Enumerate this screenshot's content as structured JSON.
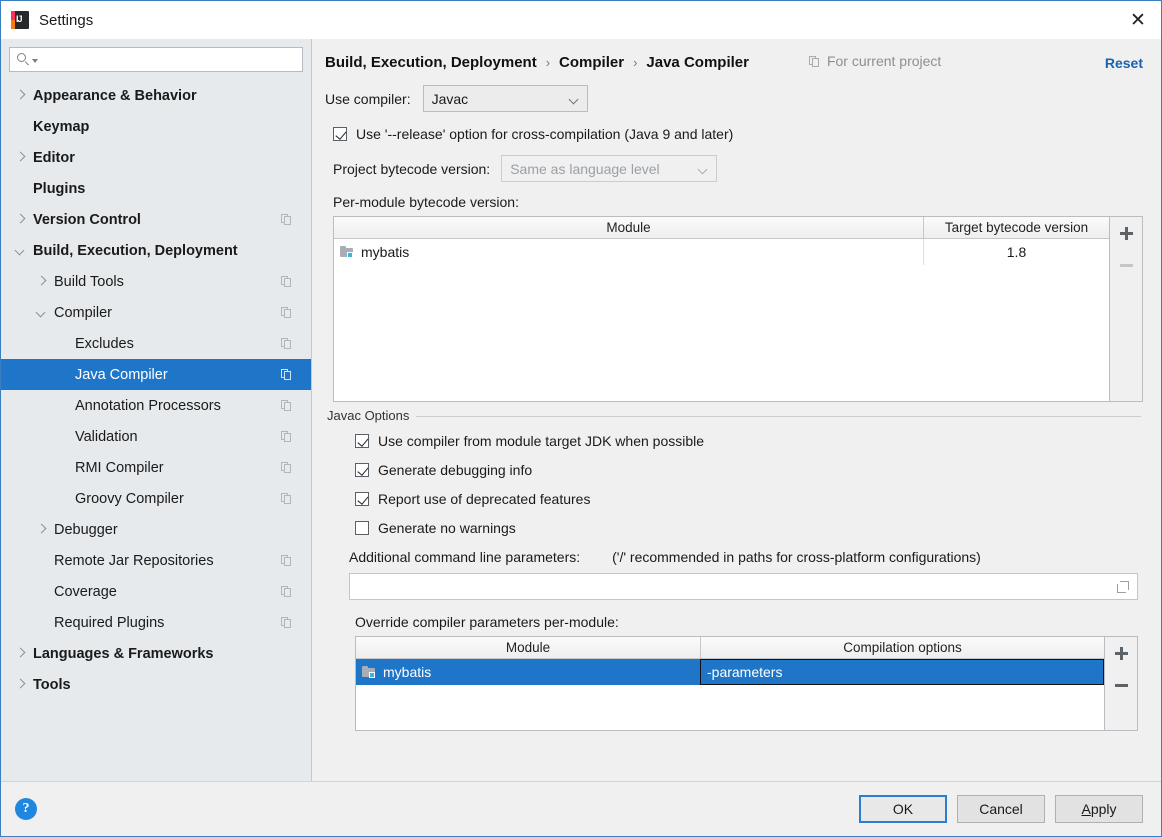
{
  "window": {
    "title": "Settings",
    "close_icon": "close-icon"
  },
  "search": {
    "value": "",
    "placeholder": ""
  },
  "sidebar": {
    "items": [
      {
        "label": "Appearance & Behavior",
        "indent": 0,
        "bold": true,
        "arrow": "right",
        "cfg": false,
        "selected": false
      },
      {
        "label": "Keymap",
        "indent": 0,
        "bold": true,
        "arrow": "none",
        "cfg": false,
        "selected": false
      },
      {
        "label": "Editor",
        "indent": 0,
        "bold": true,
        "arrow": "right",
        "cfg": false,
        "selected": false
      },
      {
        "label": "Plugins",
        "indent": 0,
        "bold": true,
        "arrow": "none",
        "cfg": false,
        "selected": false
      },
      {
        "label": "Version Control",
        "indent": 0,
        "bold": true,
        "arrow": "right",
        "cfg": true,
        "selected": false
      },
      {
        "label": "Build, Execution, Deployment",
        "indent": 0,
        "bold": true,
        "arrow": "down",
        "cfg": false,
        "selected": false
      },
      {
        "label": "Build Tools",
        "indent": 1,
        "bold": false,
        "arrow": "right",
        "cfg": true,
        "selected": false
      },
      {
        "label": "Compiler",
        "indent": 1,
        "bold": false,
        "arrow": "down",
        "cfg": true,
        "selected": false
      },
      {
        "label": "Excludes",
        "indent": 2,
        "bold": false,
        "arrow": "none",
        "cfg": true,
        "selected": false
      },
      {
        "label": "Java Compiler",
        "indent": 2,
        "bold": false,
        "arrow": "none",
        "cfg": true,
        "selected": true
      },
      {
        "label": "Annotation Processors",
        "indent": 2,
        "bold": false,
        "arrow": "none",
        "cfg": true,
        "selected": false
      },
      {
        "label": "Validation",
        "indent": 2,
        "bold": false,
        "arrow": "none",
        "cfg": true,
        "selected": false
      },
      {
        "label": "RMI Compiler",
        "indent": 2,
        "bold": false,
        "arrow": "none",
        "cfg": true,
        "selected": false
      },
      {
        "label": "Groovy Compiler",
        "indent": 2,
        "bold": false,
        "arrow": "none",
        "cfg": true,
        "selected": false
      },
      {
        "label": "Debugger",
        "indent": 1,
        "bold": false,
        "arrow": "right",
        "cfg": false,
        "selected": false
      },
      {
        "label": "Remote Jar Repositories",
        "indent": 1,
        "bold": false,
        "arrow": "none",
        "cfg": true,
        "selected": false
      },
      {
        "label": "Coverage",
        "indent": 1,
        "bold": false,
        "arrow": "none",
        "cfg": true,
        "selected": false
      },
      {
        "label": "Required Plugins",
        "indent": 1,
        "bold": false,
        "arrow": "none",
        "cfg": true,
        "selected": false
      },
      {
        "label": "Languages & Frameworks",
        "indent": 0,
        "bold": true,
        "arrow": "right",
        "cfg": false,
        "selected": false
      },
      {
        "label": "Tools",
        "indent": 0,
        "bold": true,
        "arrow": "right",
        "cfg": false,
        "selected": false
      }
    ]
  },
  "header": {
    "breadcrumb": [
      "Build, Execution, Deployment",
      "Compiler",
      "Java Compiler"
    ],
    "separator": "›",
    "scope_label": "For current project",
    "reset_label": "Reset"
  },
  "main": {
    "use_compiler_label": "Use compiler:",
    "use_compiler_value": "Javac",
    "release_option": {
      "label": "Use '--release' option for cross-compilation (Java 9 and later)",
      "checked": true
    },
    "project_bytecode_label": "Project bytecode version:",
    "project_bytecode_value": "Same as language level",
    "project_bytecode_disabled": true,
    "per_module_label": "Per-module bytecode version:",
    "bytecode_table": {
      "columns": [
        "Module",
        "Target bytecode version"
      ],
      "rows": [
        {
          "module": "mybatis",
          "version": "1.8"
        }
      ],
      "add_label": "+",
      "remove_label": "−"
    },
    "javac_group_title": "Javac Options",
    "javac_options": [
      {
        "label": "Use compiler from module target JDK when possible",
        "checked": true
      },
      {
        "label": "Generate debugging info",
        "checked": true
      },
      {
        "label": "Report use of deprecated features",
        "checked": true
      },
      {
        "label": "Generate no warnings",
        "checked": false
      }
    ],
    "additional_params_label": "Additional command line parameters:",
    "additional_params_hint": "('/' recommended in paths for cross-platform configurations)",
    "additional_params_value": "",
    "override_label": "Override compiler parameters per-module:",
    "override_table": {
      "columns": [
        "Module",
        "Compilation options"
      ],
      "rows": [
        {
          "module": "mybatis",
          "options": "-parameters",
          "selected": true
        }
      ],
      "add_label": "+",
      "remove_label": "−"
    }
  },
  "footer": {
    "help_label": "?",
    "ok_label": "OK",
    "cancel_label": "Cancel",
    "apply_label_prefix": "A",
    "apply_label_rest": "pply"
  },
  "colors": {
    "accent_blue": "#1f76c8",
    "link_blue": "#1862b0",
    "sidebar_bg": "#e6eaed",
    "panel_bg": "#f0f0f0"
  }
}
